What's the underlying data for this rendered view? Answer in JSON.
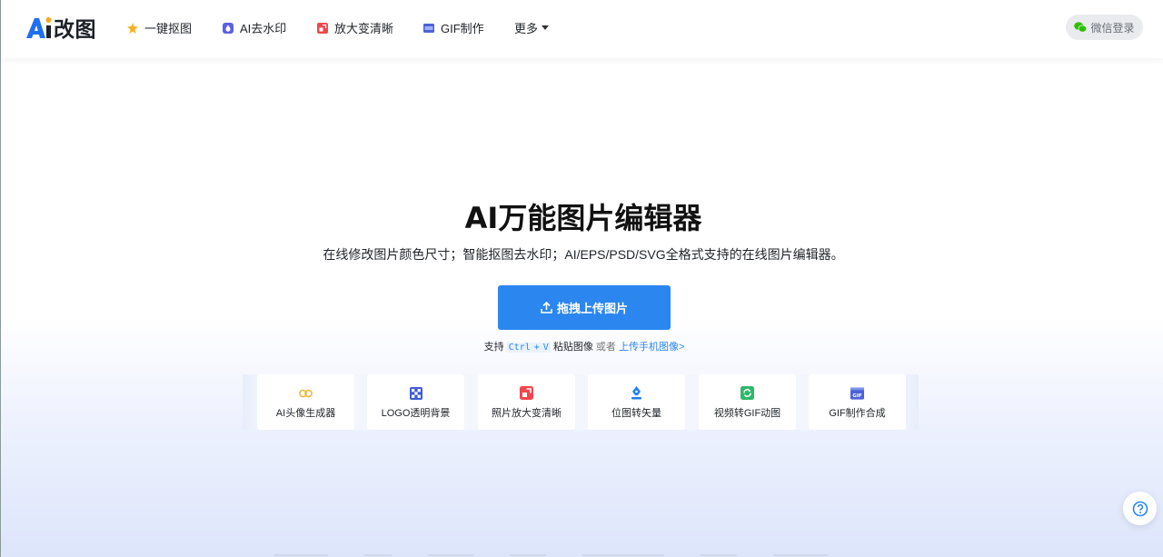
{
  "brand": {
    "logo_text": "改图",
    "accent": "#2b86f0"
  },
  "nav": {
    "items": [
      {
        "label": "一键抠图",
        "icon": "cutout-star-icon"
      },
      {
        "label": "AI去水印",
        "icon": "water-drop-icon"
      },
      {
        "label": "放大变清晰",
        "icon": "enlarge-icon"
      },
      {
        "label": "GIF制作",
        "icon": "gif-icon"
      },
      {
        "label": "更多",
        "icon": "chevron-down-icon"
      }
    ],
    "login_label": "微信登录"
  },
  "hero": {
    "title": "AI万能图片编辑器",
    "subtitle": "在线修改图片颜色尺寸；智能抠图去水印；AI/EPS/PSD/SVG全格式支持的在线图片编辑器。",
    "upload_label": "拖拽上传图片",
    "paste_prefix": "支持",
    "key_ctrl": "Ctrl",
    "key_plus": "+",
    "key_v": "V",
    "paste_suffix": "粘贴图像",
    "or_text": "或者",
    "mobile_link": "上传手机图像>"
  },
  "tools": [
    {
      "label": "AI头像生成器",
      "icon": "ai-avatar-icon"
    },
    {
      "label": "LOGO透明背景",
      "icon": "checkerboard-icon"
    },
    {
      "label": "照片放大变清晰",
      "icon": "enlarge-icon"
    },
    {
      "label": "位图转矢量",
      "icon": "pen-nib-icon"
    },
    {
      "label": "视频转GIF动图",
      "icon": "video-refresh-icon"
    },
    {
      "label": "GIF制作合成",
      "icon": "gif-icon"
    }
  ]
}
